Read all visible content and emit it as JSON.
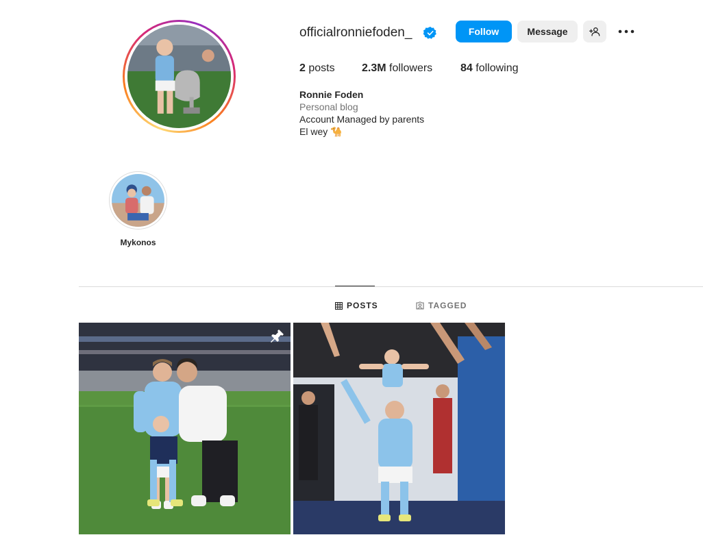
{
  "profile": {
    "username": "officialronniefoden_",
    "verified": true,
    "full_name": "Ronnie Foden",
    "category": "Personal blog",
    "bio_lines": [
      "Account Managed by parents",
      "El wey 🐪"
    ]
  },
  "actions": {
    "follow_label": "Follow",
    "message_label": "Message",
    "add_user_icon": "person-add-icon",
    "more_icon": "more-horizontal-icon"
  },
  "stats": {
    "posts_count": "2",
    "posts_label": "posts",
    "followers_count": "2.3M",
    "followers_label": "followers",
    "following_count": "84",
    "following_label": "following"
  },
  "highlights": [
    {
      "label": "Mykonos"
    }
  ],
  "tabs": [
    {
      "label": "POSTS",
      "icon": "grid-icon",
      "active": true
    },
    {
      "label": "TAGGED",
      "icon": "tag-person-icon",
      "active": false
    }
  ],
  "posts": [
    {
      "pinned": true,
      "icon": "pin-icon"
    },
    {
      "pinned": false
    }
  ],
  "colors": {
    "accent": "#0095f6",
    "secondary_button": "#efefef",
    "muted_text": "#737373",
    "divider": "#dbdbdb"
  }
}
